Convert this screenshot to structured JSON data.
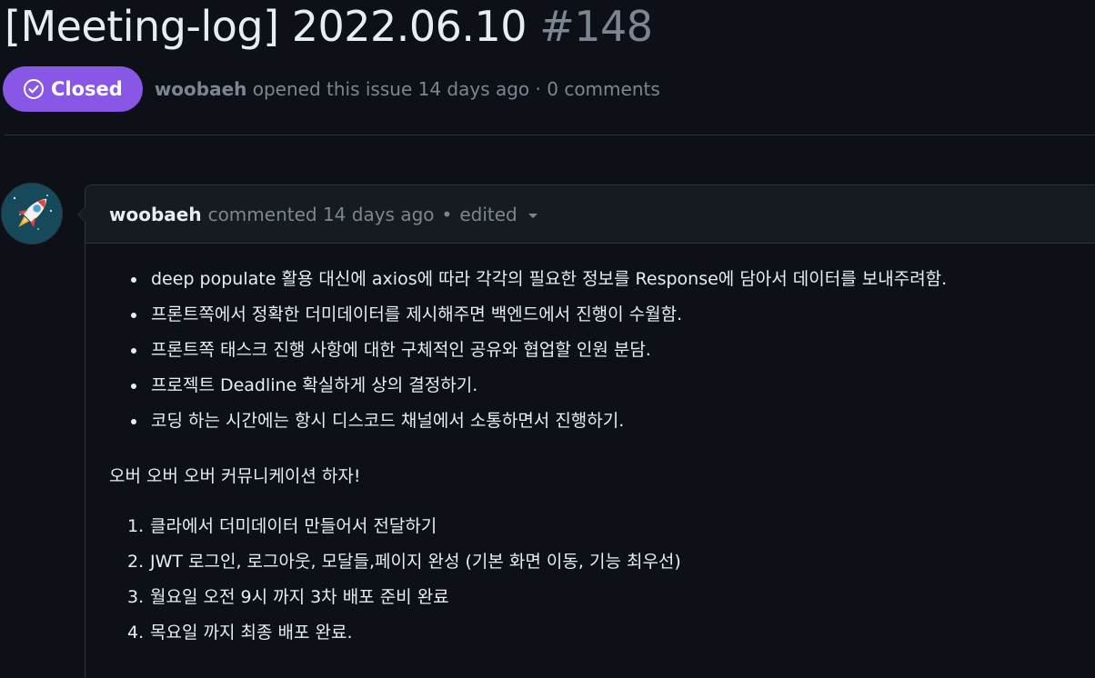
{
  "issue": {
    "title": "[Meeting-log] 2022.06.10",
    "number": "#148",
    "state": "Closed",
    "author": "woobaeh",
    "opened_text": "opened this issue 14 days ago · 0 comments"
  },
  "comment": {
    "author": "woobaeh",
    "action": "commented 14 days ago",
    "separator": "•",
    "edited": "edited",
    "bullets": [
      "deep populate 활용 대신에 axios에 따라 각각의 필요한 정보를 Response에 담아서 데이터를 보내주려함.",
      "프론트쪽에서 정확한 더미데이터를 제시해주면 백엔드에서 진행이 수월함.",
      "프론트쪽 태스크 진행 사항에 대한 구체적인 공유와 협업할 인원 분담.",
      "프로젝트 Deadline 확실하게 상의 결정하기.",
      "코딩 하는 시간에는 항시 디스코드 채널에서 소통하면서 진행하기."
    ],
    "paragraph": "오버 오버 오버 커뮤니케이션 하자!",
    "steps": [
      {
        "num": "1.",
        "text": "클라에서 더미데이터 만들어서 전달하기"
      },
      {
        "num": "2.",
        "text": "JWT 로그인, 로그아웃, 모달들,페이지 완성 (기본 화면 이동, 기능 최우선)"
      },
      {
        "num": "3.",
        "text": "월요일 오전 9시 까지 3차 배포 준비 완료"
      },
      {
        "num": "4.",
        "text": "목요일 까지 최종 배포 완료."
      }
    ]
  },
  "icons": {
    "state": "check-circle-icon",
    "avatar": "rocket-icon",
    "menu": "caret-down-icon"
  },
  "colors": {
    "background": "#0d1117",
    "closed_badge": "#8957e5",
    "muted_text": "#7d8590",
    "border": "#30363d"
  }
}
